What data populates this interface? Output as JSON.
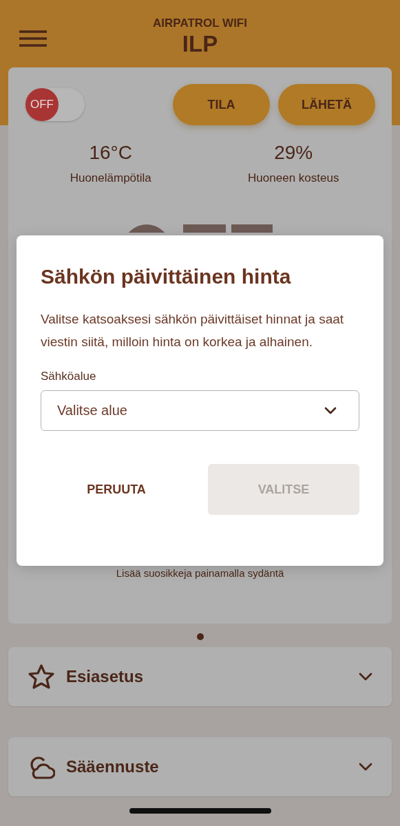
{
  "header": {
    "subtitle": "AIRPATROL WIFI",
    "title": "ILP"
  },
  "control_card": {
    "power_toggle": {
      "label": "OFF",
      "on": false
    },
    "buttons": [
      "TILA",
      "LÄHETÄ"
    ],
    "readings": [
      {
        "value": "16°C",
        "label": "Huonelämpötila"
      },
      {
        "value": "29%",
        "label": "Huoneen kosteus"
      }
    ],
    "favorites_hint": "Lisää suosikkeja painamalla sydäntä"
  },
  "page_dots": [
    {
      "selected": true
    }
  ],
  "sections": [
    {
      "kind": "star",
      "title": "Esiasetus",
      "expanded": false
    },
    {
      "kind": "cloud",
      "title": "Sääennuste",
      "expanded": false
    }
  ],
  "dialog": {
    "title": "Sähkön päivittäinen hinta",
    "text": "Valitse katsoaksesi sähkön päivittäiset hinnat ja saat viestin siitä, milloin hinta on korkea ja alhainen.",
    "field": {
      "label": "Sähköalue",
      "placeholder": "Valitse alue"
    },
    "buttons": [
      {
        "label": "PERUUTA",
        "disabled": false
      },
      {
        "label": "VALITSE",
        "disabled": true
      }
    ]
  }
}
